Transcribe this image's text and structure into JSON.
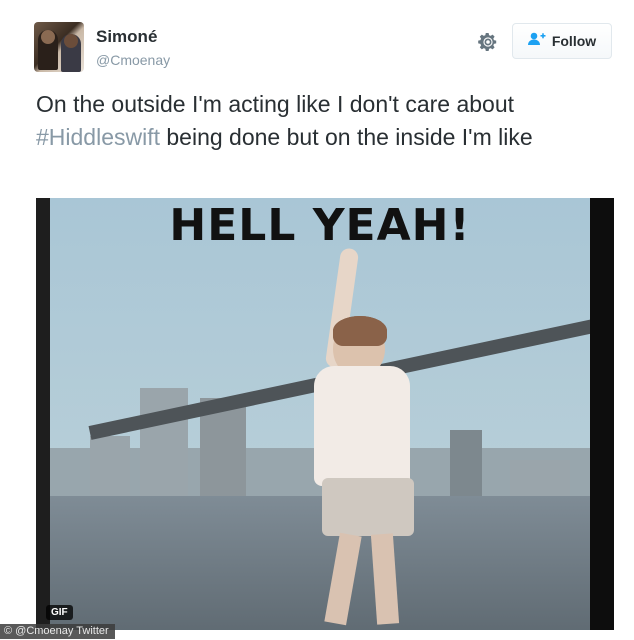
{
  "tweet": {
    "author_name": "Simoné",
    "author_handle": "@Cmoenay",
    "follow_label": "Follow",
    "text_before": "On the outside I'm acting like I don't care about ",
    "hashtag": "#Hiddleswift",
    "text_after": " being done but on the inside I'm like"
  },
  "media": {
    "caption": "HELL YEAH!",
    "badge": "GIF"
  },
  "credit": "© @Cmoenay Twitter",
  "icons": {
    "settings": "gear-icon",
    "follow": "add-user-icon"
  },
  "colors": {
    "text": "#292f33",
    "muted": "#8899a6",
    "accent": "#1da1f2"
  }
}
